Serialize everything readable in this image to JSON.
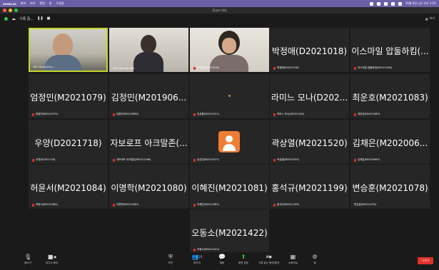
{
  "menubar": {
    "app": "zoom.us",
    "items": [
      "회의",
      "보기",
      "편집",
      "창",
      "도움말"
    ],
    "clock": "10월 6일 (금) 오후 3:51"
  },
  "window": {
    "title": "Zoom 회의"
  },
  "zoombar": {
    "meeting": "기록 중...",
    "view_label": "보기"
  },
  "tiles": [
    {
      "label": "Kim Sung-Chul ..."
    },
    {
      "label": "Seoung-seok Kim"
    },
    {
      "label": "고원지(M2021016)"
    },
    {
      "name": "박정애(D2021018)",
      "label": "박정애(D2021018)"
    },
    {
      "name": "이스마일 압둘하킴(...",
      "label": "이스마일 압둘하킴(M2021180)"
    },
    {
      "name": "엄정민(M2021079)",
      "label": "엄정민(M2021079)"
    },
    {
      "name": "김정민(M201906...",
      "label": "김정민(M2019069)"
    },
    {
      "label": "김성룡(M2021521)"
    },
    {
      "name": "라미느 모나(D202...",
      "label": "라미느 모나(D2021162)"
    },
    {
      "name": "최운호(M2021083)",
      "label": "최운호(M2021083)"
    },
    {
      "name": "우양(D2021718)",
      "label": "우양(D2021718)"
    },
    {
      "name": "자보로프 아크말존(...",
      "label": "자보로프 아크말존(M2021168)"
    },
    {
      "label": "김선영(M2021077)"
    },
    {
      "name": "곽상열(M2021520)",
      "label": "곽상열(M2021520)"
    },
    {
      "name": "김채은(M202006...",
      "label": "김채은(M2020063)"
    },
    {
      "name": "허윤서(M2021084)",
      "label": "허윤서(M2021084)"
    },
    {
      "name": "이명학(M2021080)",
      "label": "이명학(M2021080)"
    },
    {
      "name": "이혜진(M2021081)",
      "label": "이혜진(M2021081)"
    },
    {
      "name": "홍석규(M2021199)",
      "label": "홍석규(M2021199)"
    },
    {
      "name": "변승훈(M2021078)",
      "label": "변승훈(M2021078)"
    },
    {
      "name": "오동소(M2021422)",
      "label": "오동소(M2021422)"
    }
  ],
  "toolbar": {
    "mute": "음소거",
    "video": "비디오 중지",
    "security": "보안",
    "participants": "참가자",
    "participants_count": "21",
    "chat": "채팅",
    "share": "화면 공유",
    "record": "기록 일시 중지/중지",
    "breakout": "소회의실",
    "apps": "앱",
    "leave": "나가기"
  },
  "colors": {
    "active_speaker_border": "#c5d62b",
    "leave_button": "#e0302a",
    "avatar": "#f07d34",
    "share_icon": "#2ecc40"
  }
}
